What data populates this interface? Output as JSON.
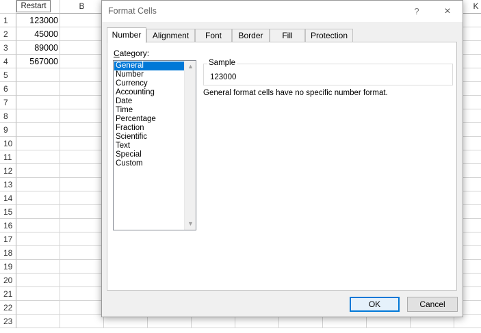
{
  "spreadsheet": {
    "columns": [
      "B",
      "K"
    ],
    "rows": [
      "1",
      "2",
      "3",
      "4",
      "5",
      "6",
      "7",
      "8",
      "9",
      "10",
      "11",
      "12",
      "13",
      "14",
      "15",
      "16",
      "17",
      "18",
      "19",
      "20",
      "21",
      "22",
      "23"
    ],
    "column_a_values": [
      "123000",
      "45000",
      "89000",
      "567000"
    ],
    "restart_label": "Restart"
  },
  "dialog": {
    "title": "Format Cells",
    "help_icon": "?",
    "close_icon": "×",
    "tabs": [
      "Number",
      "Alignment",
      "Font",
      "Border",
      "Fill",
      "Protection"
    ],
    "active_tab": "Number",
    "category_label_underlined": "C",
    "category_label_rest": "ategory:",
    "categories": [
      "General",
      "Number",
      "Currency",
      "Accounting",
      "Date",
      "Time",
      "Percentage",
      "Fraction",
      "Scientific",
      "Text",
      "Special",
      "Custom"
    ],
    "selected_category": "General",
    "sample_label": "Sample",
    "sample_value": "123000",
    "description": "General format cells have no specific number format.",
    "ok_label": "OK",
    "cancel_label": "Cancel",
    "accent_color": "#0078d7"
  }
}
